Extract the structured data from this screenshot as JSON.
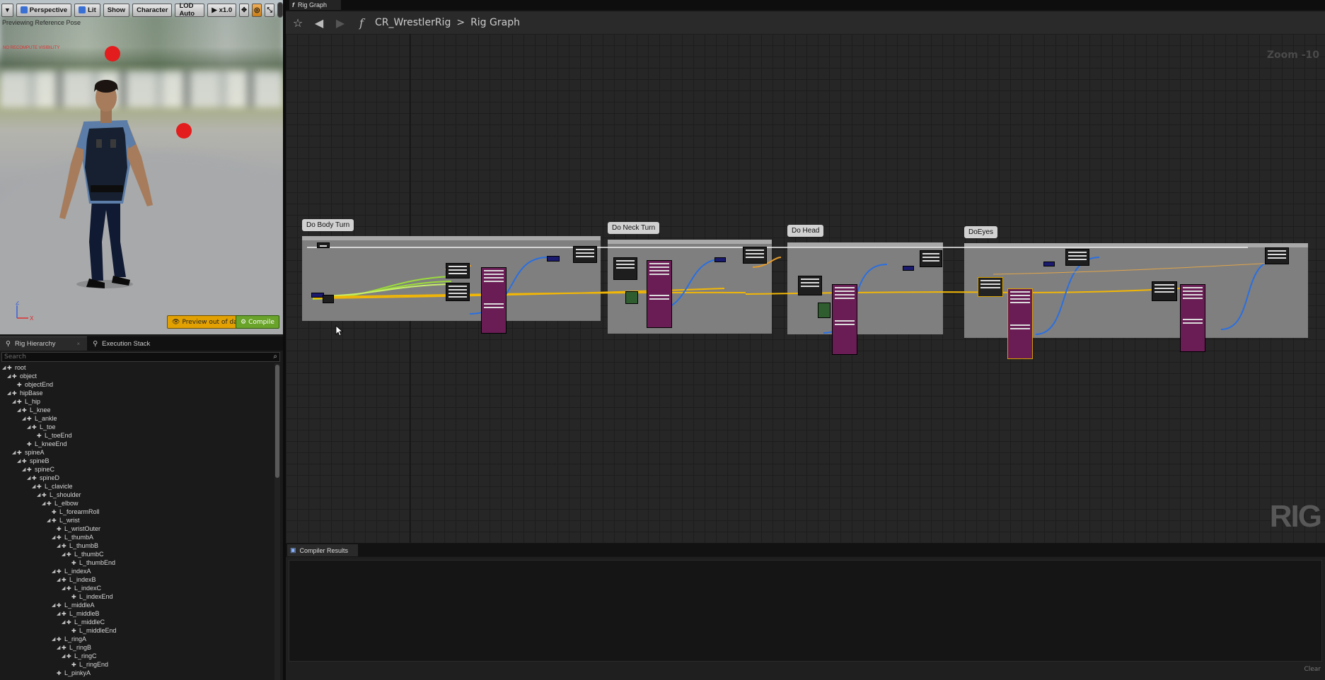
{
  "viewport": {
    "toolbar": {
      "menu_label": "▾",
      "perspective": "Perspective",
      "lit": "Lit",
      "show": "Show",
      "character": "Character",
      "lod": "LOD Auto",
      "speed": "x1.0"
    },
    "pose_text": "Previewing Reference Pose",
    "warning_text": "NO RECOMPUTE VISIBILITY",
    "axis_z": "Z",
    "axis_x": "X",
    "preview_button": "Preview out of date",
    "compile_button": "Compile"
  },
  "hierarchy": {
    "tabs": [
      {
        "label": "Rig Hierarchy",
        "close": "×"
      },
      {
        "label": "Execution Stack"
      }
    ],
    "search_placeholder": "Search",
    "items": [
      {
        "label": "root",
        "depth": 0
      },
      {
        "label": "object",
        "depth": 1
      },
      {
        "label": "objectEnd",
        "depth": 2
      },
      {
        "label": "hipBase",
        "depth": 1
      },
      {
        "label": "L_hip",
        "depth": 2
      },
      {
        "label": "L_knee",
        "depth": 3
      },
      {
        "label": "L_ankle",
        "depth": 4
      },
      {
        "label": "L_toe",
        "depth": 5
      },
      {
        "label": "L_toeEnd",
        "depth": 6
      },
      {
        "label": "L_kneeEnd",
        "depth": 4
      },
      {
        "label": "spineA",
        "depth": 2
      },
      {
        "label": "spineB",
        "depth": 3
      },
      {
        "label": "spineC",
        "depth": 4
      },
      {
        "label": "spineD",
        "depth": 5
      },
      {
        "label": "L_clavicle",
        "depth": 6
      },
      {
        "label": "L_shoulder",
        "depth": 7
      },
      {
        "label": "L_elbow",
        "depth": 8
      },
      {
        "label": "L_forearmRoll",
        "depth": 9
      },
      {
        "label": "L_wrist",
        "depth": 9
      },
      {
        "label": "L_wristOuter",
        "depth": 10
      },
      {
        "label": "L_thumbA",
        "depth": 10
      },
      {
        "label": "L_thumbB",
        "depth": 11
      },
      {
        "label": "L_thumbC",
        "depth": 12
      },
      {
        "label": "L_thumbEnd",
        "depth": 13
      },
      {
        "label": "L_indexA",
        "depth": 10
      },
      {
        "label": "L_indexB",
        "depth": 11
      },
      {
        "label": "L_indexC",
        "depth": 12
      },
      {
        "label": "L_indexEnd",
        "depth": 13
      },
      {
        "label": "L_middleA",
        "depth": 10
      },
      {
        "label": "L_middleB",
        "depth": 11
      },
      {
        "label": "L_middleC",
        "depth": 12
      },
      {
        "label": "L_middleEnd",
        "depth": 13
      },
      {
        "label": "L_ringA",
        "depth": 10
      },
      {
        "label": "L_ringB",
        "depth": 11
      },
      {
        "label": "L_ringC",
        "depth": 12
      },
      {
        "label": "L_ringEnd",
        "depth": 13
      },
      {
        "label": "L_pinkyA",
        "depth": 10
      }
    ]
  },
  "graph": {
    "tab_label": "Rig Graph",
    "breadcrumb_root": "CR_WrestlerRig",
    "breadcrumb_sep": ">",
    "breadcrumb_current": "Rig Graph",
    "zoom_label": "Zoom -10",
    "watermark": "RIG",
    "comments": [
      "Do Body Turn",
      "Do Neck Turn",
      "Do Head",
      "DoEyes"
    ]
  },
  "compiler": {
    "tab_label": "Compiler Results",
    "clear_label": "Clear"
  },
  "colors": {
    "accent_blue": "#3a6fd3",
    "compile_green": "#69a329",
    "preview_gold": "#e2a100",
    "wire_yellow": "#f2b705",
    "wire_blue": "#2a6fe0",
    "wire_green": "#9bdc3a",
    "node_purple": "#6a1d55"
  },
  "icons": [
    "function-icon",
    "star-icon",
    "back-icon",
    "forward-icon",
    "bone-icon",
    "search-icon",
    "compile-icon",
    "eye-icon"
  ]
}
